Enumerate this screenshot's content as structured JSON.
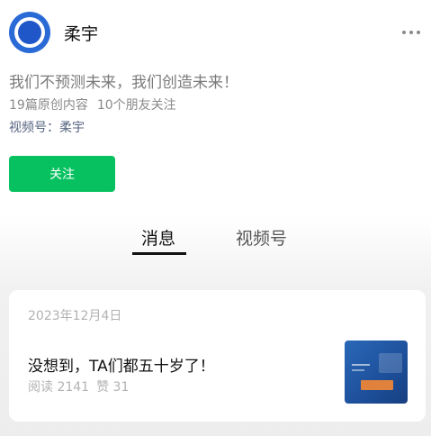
{
  "profile": {
    "name": "柔宇",
    "bio": "我们不预测未来，我们创造未来！",
    "original_count": "19篇原创内容",
    "friends_following": "10个朋友关注",
    "channel_label": "视频号：柔宇",
    "follow_label": "关注",
    "avatar_colors": [
      "#2a6ad6",
      "#ffffff",
      "#1f57c8"
    ]
  },
  "header": {
    "more_icon": "more-dots-icon"
  },
  "tabs": [
    {
      "label": "消息",
      "active": true
    },
    {
      "label": "视频号",
      "active": false
    }
  ],
  "article": {
    "date": "2023年12月4日",
    "title": "没想到，TA们都五十岁了！",
    "reads": "阅读 2141",
    "likes": "赞 31"
  },
  "colors": {
    "accent": "#07c160",
    "channel_link": "#566480"
  }
}
